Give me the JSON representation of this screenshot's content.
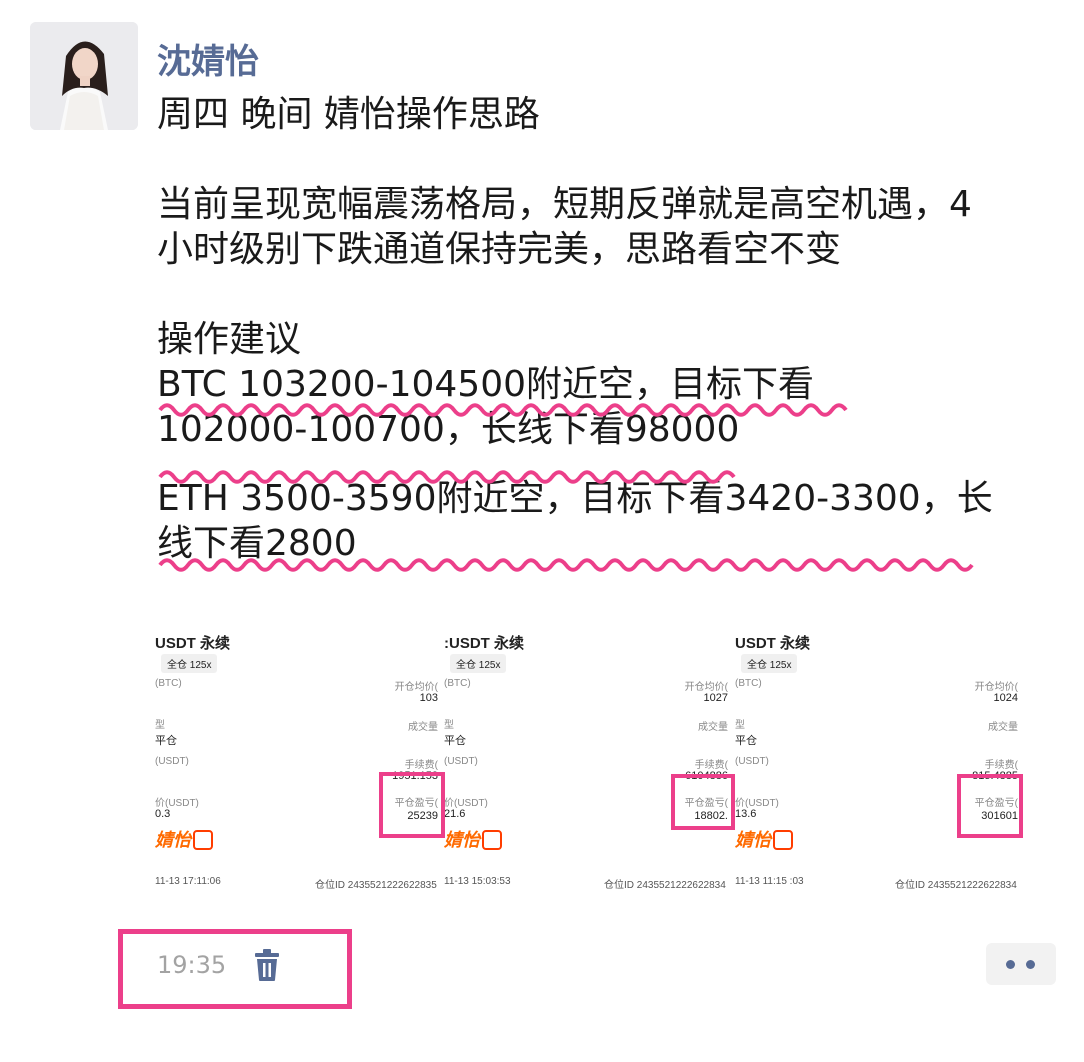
{
  "post": {
    "author": "沈婧怡",
    "line_title": "周四  晚间  婧怡操作思路",
    "para1_line1": "当前呈现宽幅震荡格局，短期反弹就是高空机遇，4",
    "para1_line2": "小时级别下跌通道保持完美，思路看空不变",
    "advice_heading": "操作建议",
    "btc_line1": "BTC   103200-104500附近空，目标下看",
    "btc_line2": "102000-100700，长线下看98000",
    "eth_line1": "ETH  3500-3590附近空，目标下看3420-3300，长",
    "eth_line2": "线下看2800"
  },
  "screenshots": [
    {
      "pair": "USDT 永续",
      "mode": "全仓 125x",
      "asset": "(BTC)",
      "open_avg_label": "开仓均价(",
      "open_avg_value": "103",
      "type_label": "型",
      "volume_label": "成交量",
      "close_label": "平仓",
      "fee_label_left": "(USDT)",
      "fee_label": "手续费(",
      "fee_value": "1951.153",
      "close_price_label": "价(USDT)",
      "pnl_label": "平仓盈亏(",
      "close_price_value": "0.3",
      "pnl_value": "25239",
      "stamp": "婧怡",
      "timestamp": "11-13  17:11:06",
      "position_id": "仓位ID 2435521222622835"
    },
    {
      "pair": ":USDT 永续",
      "mode": "全仓 125x",
      "asset": "(BTC)",
      "open_avg_label": "开仓均价(",
      "open_avg_value": "1027",
      "type_label": "型",
      "volume_label": "成交量",
      "close_label": "平仓",
      "fee_label_left": "(USDT)",
      "fee_label": "手续费(",
      "fee_value": "6104886",
      "close_price_label": "价(USDT)",
      "pnl_label": "平仓盈亏(",
      "close_price_value": "21.6",
      "pnl_value": "18802.",
      "stamp": "婧怡",
      "timestamp": "11-13  15:03:53",
      "position_id": "仓位ID 2435521222622834"
    },
    {
      "pair": "USDT 永续",
      "mode": "全仓 125x",
      "asset": "(BTC)",
      "open_avg_label": "开仓均价(",
      "open_avg_value": "1024",
      "type_label": "型",
      "volume_label": "成交量",
      "close_label": "平仓",
      "fee_label_left": "(USDT)",
      "fee_label": "手续费(",
      "fee_value": "815.4885",
      "close_price_label": "价(USDT)",
      "pnl_label": "平仓盈亏(",
      "close_price_value": "13.6",
      "pnl_value": "301601",
      "stamp": "婧怡",
      "timestamp": "11-13  11:15 :03",
      "position_id": "仓位ID 2435521222622834"
    }
  ],
  "footer": {
    "time": "19:35"
  },
  "icons": {
    "delete": "trash-icon",
    "more": "more-dots-icon"
  },
  "colors": {
    "author": "#576b95",
    "highlight": "#ec3f8a",
    "timestamp": "#a3a3a3"
  }
}
